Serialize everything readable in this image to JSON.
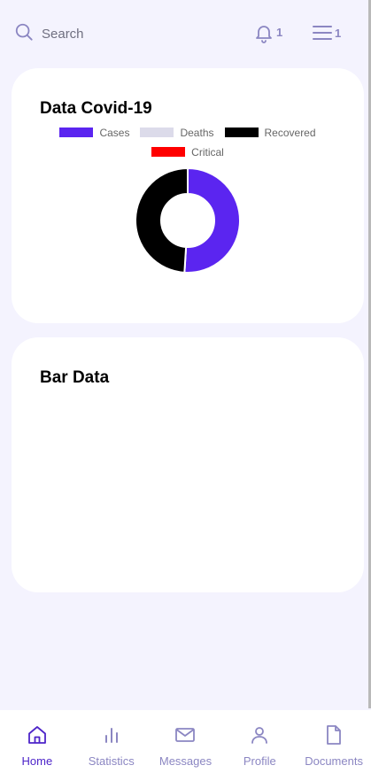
{
  "header": {
    "search_placeholder": "Search",
    "notification_count": "1",
    "menu_count": "1",
    "icon_color": "#8b86c2"
  },
  "covid_card": {
    "title": "Data Covid-19"
  },
  "bar_card": {
    "title": "Bar Data"
  },
  "chart_data": {
    "type": "pie",
    "variant": "doughnut",
    "legend_position": "top",
    "categories": [
      "Cases",
      "Deaths",
      "Recovered",
      "Critical"
    ],
    "colors": [
      "#5b25f0",
      "#dcdbea",
      "#000000",
      "#ff0000"
    ],
    "values": [
      51,
      0,
      49,
      0
    ]
  },
  "nav": {
    "items": [
      {
        "label": "Home",
        "icon": "home-icon",
        "active": true
      },
      {
        "label": "Statistics",
        "icon": "bar-chart-icon",
        "active": false
      },
      {
        "label": "Messages",
        "icon": "mail-icon",
        "active": false
      },
      {
        "label": "Profile",
        "icon": "user-icon",
        "active": false
      },
      {
        "label": "Documents",
        "icon": "document-icon",
        "active": false
      }
    ],
    "active_color": "#4d24c9",
    "inactive_color": "#8b86c2"
  }
}
